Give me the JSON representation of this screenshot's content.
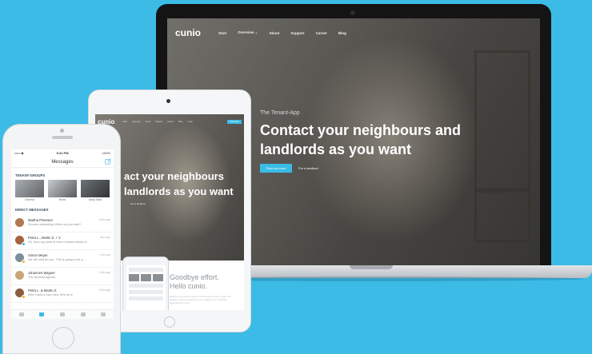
{
  "laptop": {
    "site": {
      "logo": "cunio",
      "nav": [
        "Start",
        "Overview ⌄",
        "About",
        "Support",
        "Career",
        "Blog"
      ],
      "eyebrow": "The Tenant-App",
      "headline": "Contact your neighbours and landlords as you want",
      "cta_primary": "Find out more",
      "cta_secondary": "For a landlord"
    }
  },
  "tablet": {
    "logo": "cunio",
    "nav": [
      "Start",
      "Overview",
      "News",
      "Support",
      "Career",
      "Blog",
      "Login"
    ],
    "nav_button": "Download",
    "headline": "act your neighbours\nlandlords as you want",
    "link": "For a landlord",
    "section_title": "Goodbye effort.\nHello cunio.",
    "section_text": "Whether you need to agree upon the house rules, contact the landlord, receive a parcel for your neighbour or coordinate appointments: cunio"
  },
  "phone": {
    "status": {
      "carrier": "••••• ◉",
      "time": "9:41 PM",
      "battery": "100%"
    },
    "header_title": "Messages",
    "groups_label": "TENANT-GROUPS",
    "groups": [
      {
        "name": "General"
      },
      {
        "name": "News"
      },
      {
        "name": "Swap Mark"
      }
    ],
    "messages_label": "DIRECT MESSAGES",
    "messages": [
      {
        "name": "Martha Petersen",
        "text": "Sounds interesting! When do you start?",
        "time": "12min ago",
        "avatar_color": "#b07a52",
        "badge": "none"
      },
      {
        "name": "Petra L., Martin Z. + 3",
        "text": "Ok, from my point of view it makes sense to...",
        "time": "5min ago",
        "avatar_color": "#a5623c",
        "badge": "blue"
      },
      {
        "name": "Simon Meyer",
        "text": "We will wait for you. This is going to be a...",
        "time": "2 min ago",
        "avatar_color": "#7d8e9a",
        "badge": "yellow"
      },
      {
        "name": "Johannes Wagner",
        "text": "The landlord agreed.",
        "time": "5 min ago",
        "avatar_color": "#c9a57b",
        "badge": "none"
      },
      {
        "name": "Petra L. & Martin Z.",
        "text": "Well, that's a nice idea, let's do it!",
        "time": "5 min ago",
        "avatar_color": "#8a5e45",
        "badge": "yellow"
      }
    ],
    "tabs": [
      "home-icon",
      "messages-icon",
      "groups-icon",
      "support-icon",
      "settings-icon"
    ],
    "active_tab": 1
  },
  "colors": {
    "background": "#3bbbe6",
    "accent": "#3bbbe6",
    "badge_yellow": "#f2b531"
  }
}
